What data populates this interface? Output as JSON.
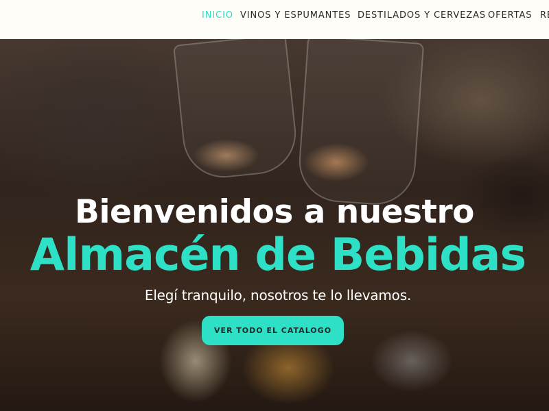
{
  "nav": {
    "items": [
      {
        "label": "INICIO",
        "active": true
      },
      {
        "label": "VINOS Y ESPUMANTES",
        "active": false
      },
      {
        "label": "DESTILADOS Y CERVEZAS",
        "active": false
      },
      {
        "label": "OFERTAS",
        "active": false
      },
      {
        "label": "RE",
        "active": false
      }
    ]
  },
  "hero": {
    "title_line1": "Bienvenidos a nuestro",
    "title_line2": "Almacén de Bebidas",
    "subtitle": "Elegí tranquilo, nosotros te lo llevamos.",
    "cta_label": "VER TODO EL CATALOGO"
  },
  "colors": {
    "accent": "#2ee0c5",
    "background": "#fffdf7",
    "nav_text": "#2a2a2a"
  }
}
